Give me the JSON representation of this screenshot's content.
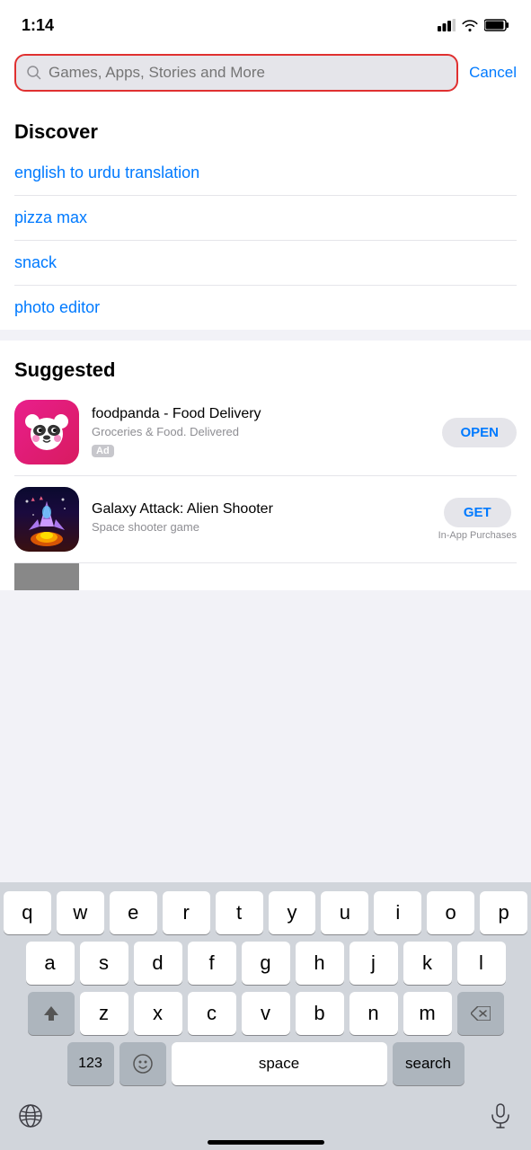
{
  "statusBar": {
    "time": "1:14",
    "signalBars": "signal-icon",
    "wifi": "wifi-icon",
    "battery": "battery-icon"
  },
  "searchBar": {
    "placeholder": "Games, Apps, Stories and More",
    "cancelLabel": "Cancel",
    "borderColor": "#e03030"
  },
  "discover": {
    "sectionTitle": "Discover",
    "items": [
      {
        "label": "english to urdu translation"
      },
      {
        "label": "pizza max"
      },
      {
        "label": "snack"
      },
      {
        "label": "photo editor"
      }
    ]
  },
  "suggested": {
    "sectionTitle": "Suggested",
    "apps": [
      {
        "name": "foodpanda - Food Delivery",
        "subtitle": "Groceries & Food. Delivered",
        "badge": "Ad",
        "actionLabel": "OPEN",
        "actionType": "open",
        "inAppPurchases": ""
      },
      {
        "name": "Galaxy Attack: Alien Shooter",
        "subtitle": "Space shooter game",
        "badge": "",
        "actionLabel": "GET",
        "actionType": "get",
        "inAppPurchases": "In-App Purchases"
      }
    ]
  },
  "keyboard": {
    "rows": [
      [
        "q",
        "w",
        "e",
        "r",
        "t",
        "y",
        "u",
        "i",
        "o",
        "p"
      ],
      [
        "a",
        "s",
        "d",
        "f",
        "g",
        "h",
        "j",
        "k",
        "l"
      ],
      [
        "z",
        "x",
        "c",
        "v",
        "b",
        "n",
        "m"
      ]
    ],
    "spaceLabel": "space",
    "searchLabel": "search",
    "numbersLabel": "123",
    "shiftIcon": "shift-icon",
    "deleteIcon": "delete-icon",
    "globeIcon": "globe-icon",
    "micIcon": "mic-icon"
  }
}
